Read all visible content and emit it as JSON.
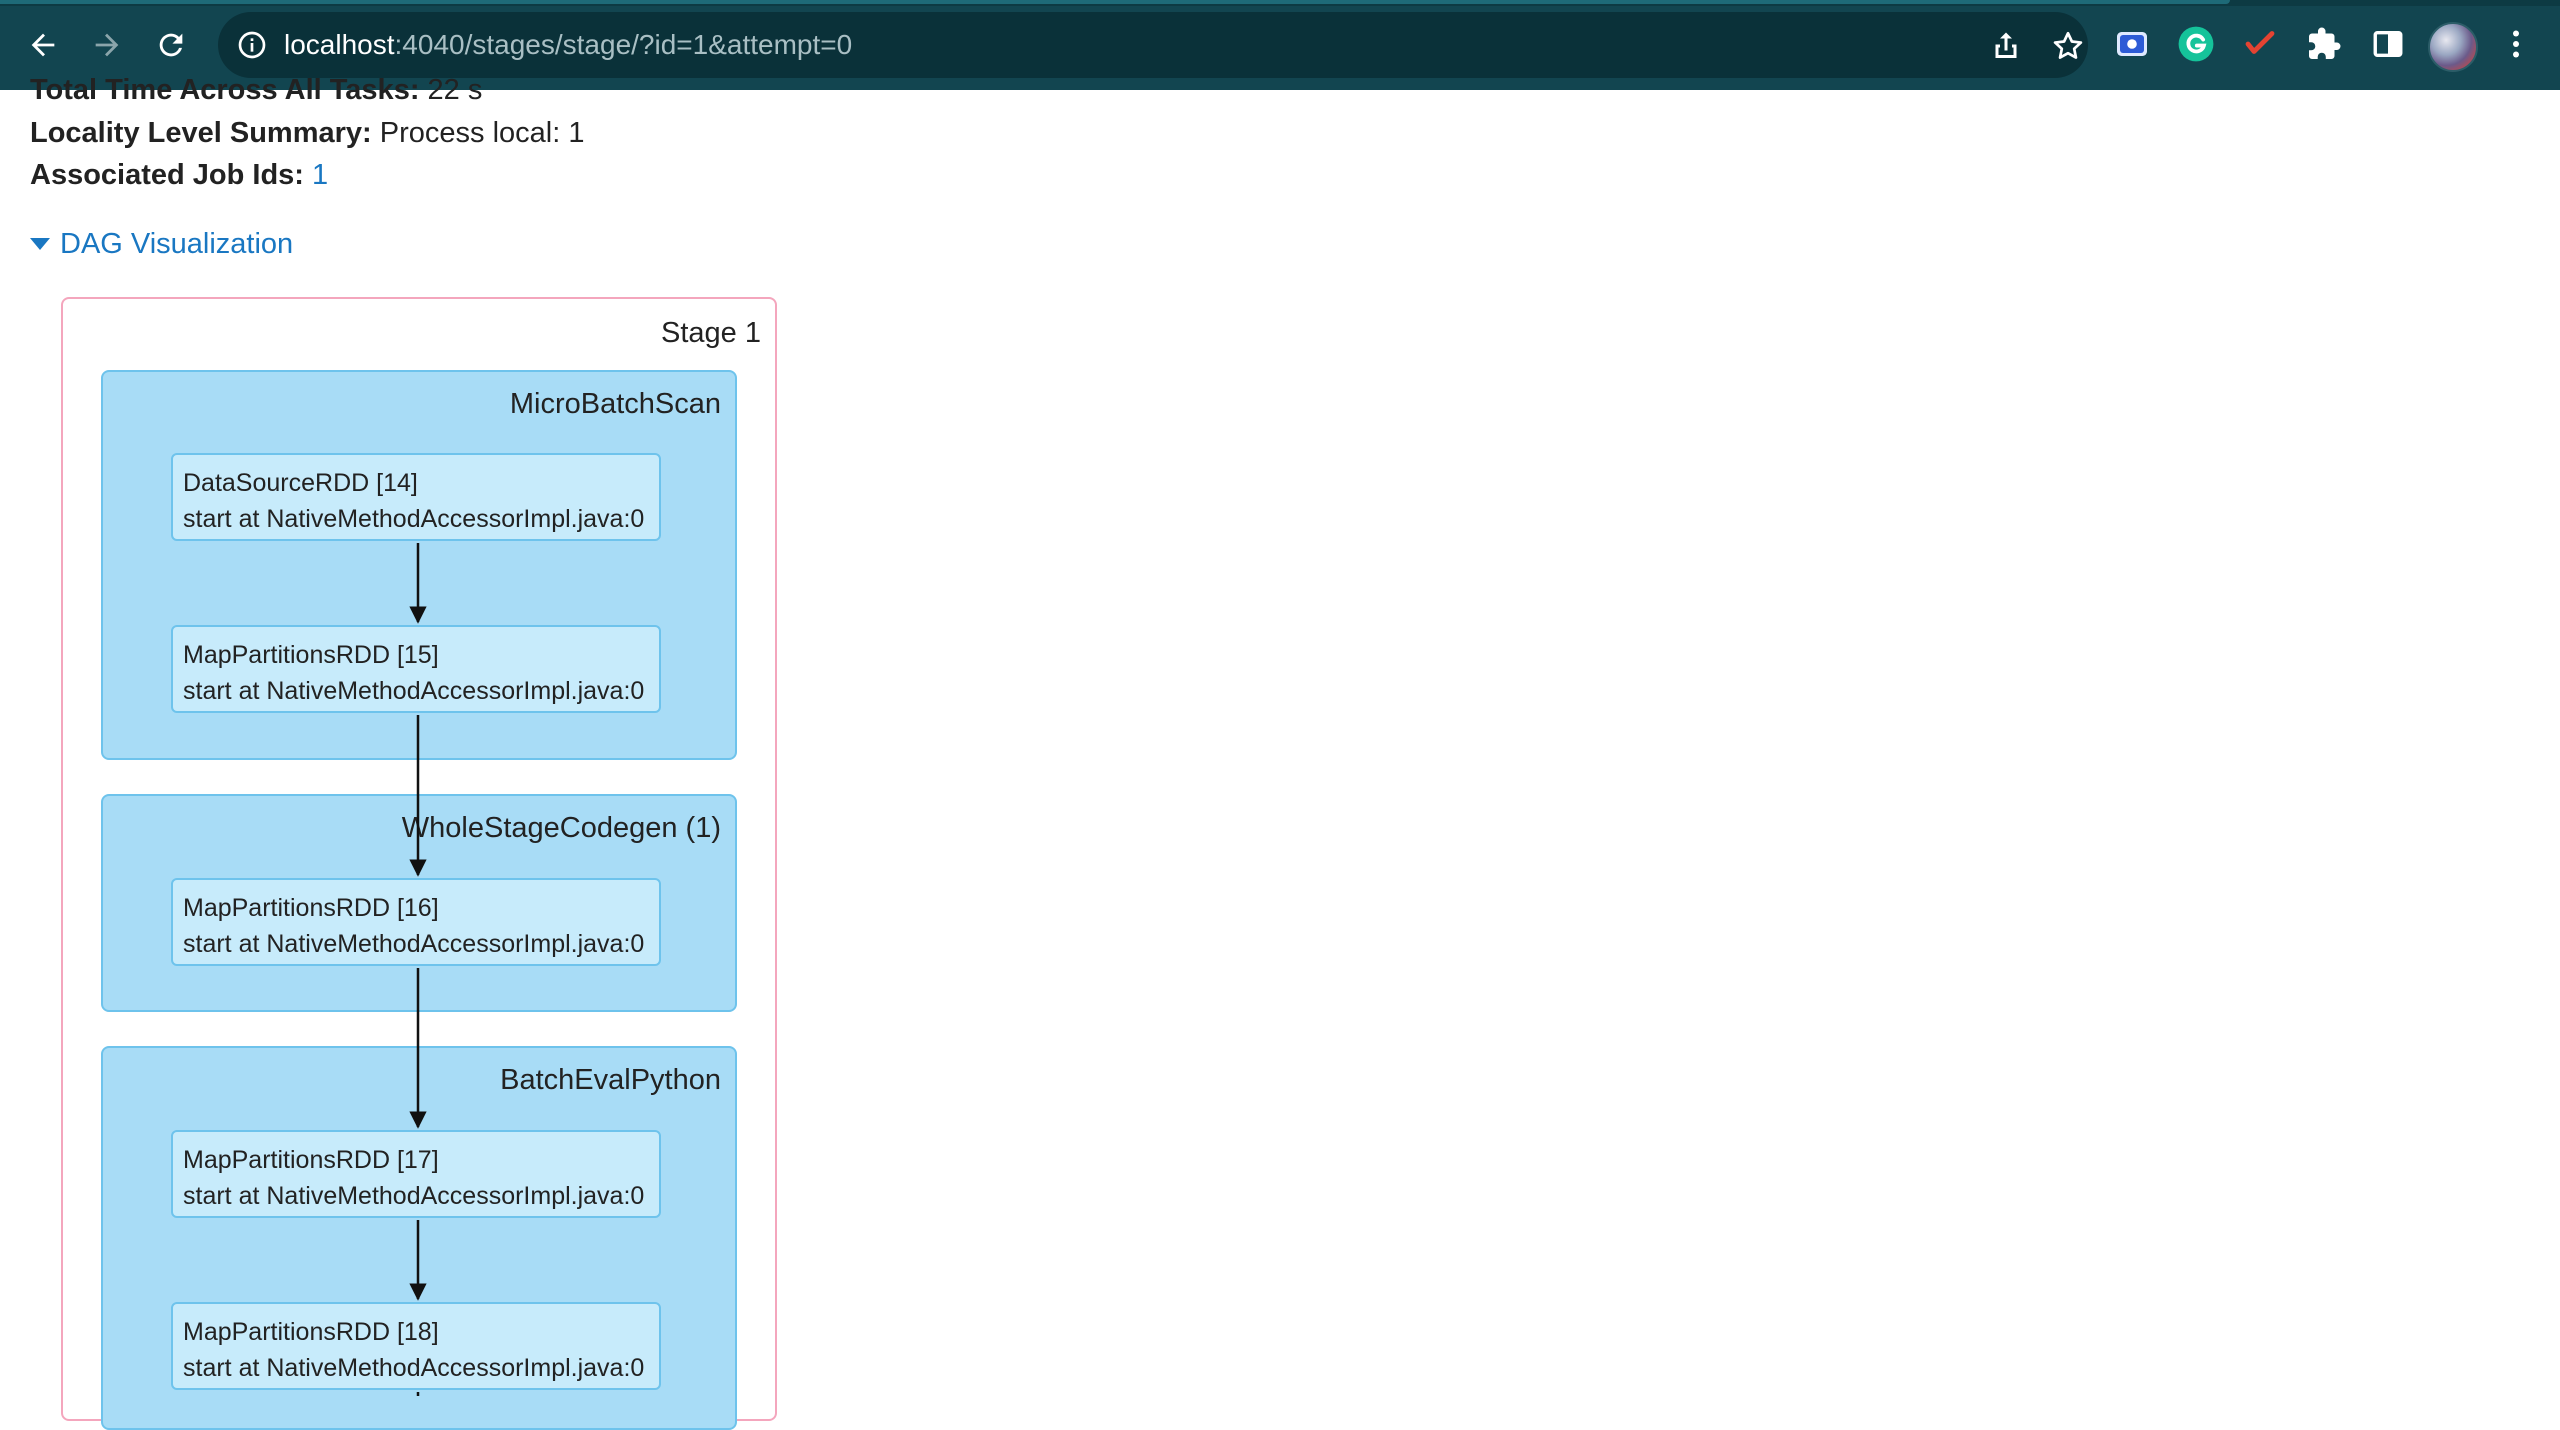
{
  "browser": {
    "url_host": "localhost",
    "url_rest": ":4040/stages/stage/?id=1&attempt=0",
    "icons": [
      "back-icon",
      "forward-icon",
      "reload-icon",
      "info-icon",
      "share-icon",
      "star-icon",
      "screen-capture-icon",
      "grammarly-icon",
      "todoist-icon",
      "extensions-icon",
      "side-panel-icon",
      "avatar",
      "menu-icon"
    ]
  },
  "summary": {
    "total_time_label": "Total Time Across All Tasks:",
    "total_time_value": "22 s",
    "locality_label": "Locality Level Summary:",
    "locality_value": "Process local: 1",
    "job_ids_label": "Associated Job Ids:",
    "job_ids_value": "1"
  },
  "dag": {
    "toggle_label": "DAG Visualization",
    "stage_label": "Stage 1",
    "clusters": [
      {
        "label": "MicroBatchScan",
        "nodes": [
          {
            "name": "DataSourceRDD [14]",
            "detail": "start at NativeMethodAccessorImpl.java:0"
          },
          {
            "name": "MapPartitionsRDD [15]",
            "detail": "start at NativeMethodAccessorImpl.java:0"
          }
        ]
      },
      {
        "label": "WholeStageCodegen (1)",
        "nodes": [
          {
            "name": "MapPartitionsRDD [16]",
            "detail": "start at NativeMethodAccessorImpl.java:0"
          }
        ]
      },
      {
        "label": "BatchEvalPython",
        "nodes": [
          {
            "name": "MapPartitionsRDD [17]",
            "detail": "start at NativeMethodAccessorImpl.java:0"
          },
          {
            "name": "MapPartitionsRDD [18]",
            "detail": "start at NativeMethodAccessorImpl.java:0"
          }
        ]
      }
    ]
  }
}
